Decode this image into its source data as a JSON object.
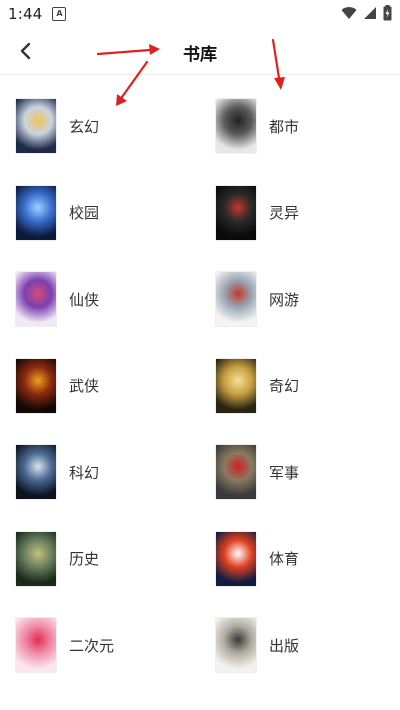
{
  "status_bar": {
    "time": "1:44",
    "notification_icon": "a-notification-icon",
    "icons": [
      "wifi-icon",
      "signal-icon",
      "battery-charging-icon"
    ]
  },
  "header": {
    "back_icon": "chevron-left-icon",
    "title": "书库"
  },
  "categories": [
    {
      "label": "玄幻",
      "cover_text": "",
      "cover_colors": [
        "#1d2a4a",
        "#c9d3e0",
        "#f1c35a"
      ]
    },
    {
      "label": "都市",
      "cover_text": "",
      "cover_colors": [
        "#e8e8e8",
        "#5a5a5a",
        "#222222"
      ]
    },
    {
      "label": "校园",
      "cover_text": "",
      "cover_colors": [
        "#0b1a3a",
        "#3a6fd0",
        "#9fd1ff"
      ]
    },
    {
      "label": "灵异",
      "cover_text": "",
      "cover_colors": [
        "#0a0a0a",
        "#2a2a2a",
        "#c0392b"
      ]
    },
    {
      "label": "仙侠",
      "cover_text": "",
      "cover_colors": [
        "#f2e9f7",
        "#7b3fb0",
        "#d64a7a"
      ]
    },
    {
      "label": "网游",
      "cover_text": "",
      "cover_colors": [
        "#f3f3f3",
        "#9aa6b4",
        "#c0392b"
      ]
    },
    {
      "label": "武侠",
      "cover_text": "",
      "cover_colors": [
        "#120805",
        "#8a2a10",
        "#f0a020"
      ]
    },
    {
      "label": "奇幻",
      "cover_text": "",
      "cover_colors": [
        "#2a2412",
        "#c8a040",
        "#f4e19a"
      ]
    },
    {
      "label": "科幻",
      "cover_text": "",
      "cover_colors": [
        "#0c1220",
        "#4b6a92",
        "#d8e4f0"
      ]
    },
    {
      "label": "军事",
      "cover_text": "",
      "cover_colors": [
        "#3a3a3a",
        "#8a7a60",
        "#d02020"
      ]
    },
    {
      "label": "历史",
      "cover_text": "",
      "cover_colors": [
        "#1a2a1a",
        "#6a8060",
        "#c8c07a"
      ]
    },
    {
      "label": "体育",
      "cover_text": "",
      "cover_colors": [
        "#101c40",
        "#e04020",
        "#ffffff"
      ]
    },
    {
      "label": "二次元",
      "cover_text": "",
      "cover_colors": [
        "#fbe6ee",
        "#f08aa8",
        "#e03050"
      ]
    },
    {
      "label": "出版",
      "cover_text": "",
      "cover_colors": [
        "#f4f2ee",
        "#b0aaa0",
        "#3a3a3a"
      ]
    }
  ],
  "annotation_color": "#e02020"
}
